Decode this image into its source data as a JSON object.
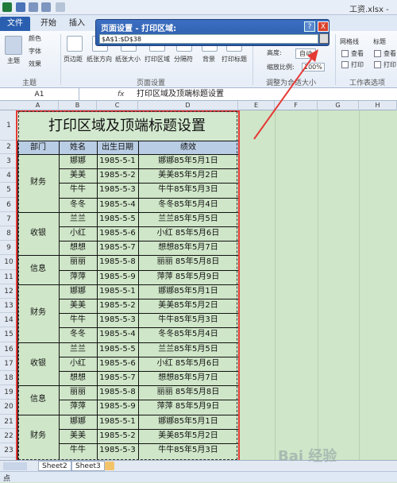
{
  "window": {
    "doc_title": "工资.xlsx - M"
  },
  "tabs": [
    {
      "label": "文件"
    },
    {
      "label": "开始"
    },
    {
      "label": "插入"
    }
  ],
  "ribbon": {
    "theme_group": {
      "theme_label": "主题",
      "colors_label": "颜色",
      "fonts_label": "字体",
      "effects_label": "效果",
      "group_label": "主题"
    },
    "page_setup": {
      "margins": "页边距",
      "orientation": "纸张方向",
      "size": "纸张大小",
      "print_area": "打印区域",
      "breaks": "分隔符",
      "background": "背景",
      "print_titles": "打印标题",
      "group_label": "页面设置"
    },
    "scale_fit": {
      "height_label": "高度:",
      "height_value": "自动",
      "scale_label": "缩放比例:",
      "scale_value": "100%",
      "group_label": "调整为合适大小"
    },
    "sheet_options": {
      "gridlines": "网格线",
      "headings": "标题",
      "view1": "查看",
      "view2": "查看",
      "print1": "打印",
      "print2": "打印",
      "group_label": "工作表选项"
    }
  },
  "dialog": {
    "title": "页面设置 - 打印区域:",
    "range": "$A$1:$D$38",
    "help": "?",
    "close": "X"
  },
  "formula_bar": {
    "name_box": "A1",
    "fx": "fx",
    "content": "打印区域及顶端标题设置"
  },
  "columns": [
    "A",
    "B",
    "C",
    "D",
    "E",
    "F",
    "G",
    "H"
  ],
  "rows": [
    "1",
    "2",
    "3",
    "4",
    "5",
    "6",
    "7",
    "8",
    "9",
    "10",
    "11",
    "12",
    "13",
    "14",
    "15",
    "16",
    "17",
    "18",
    "19",
    "20",
    "21",
    "22",
    "23"
  ],
  "sheet": {
    "title": "打印区域及顶端标题设置",
    "headers": [
      "部门",
      "姓名",
      "出生日期",
      "绩效"
    ],
    "departments": [
      {
        "label": "财务"
      },
      {
        "label": "收银"
      },
      {
        "label": "信息"
      },
      {
        "label": "财务"
      },
      {
        "label": "收银"
      },
      {
        "label": "信息"
      },
      {
        "label": "财务"
      }
    ],
    "data_rows": [
      {
        "name": "娜娜",
        "date": "1985-5-1",
        "perf": "娜娜85年5月1日"
      },
      {
        "name": "美美",
        "date": "1985-5-2",
        "perf": "美美85年5月2日"
      },
      {
        "name": "牛牛",
        "date": "1985-5-3",
        "perf": "牛牛85年5月3日"
      },
      {
        "name": "冬冬",
        "date": "1985-5-4",
        "perf": "冬冬85年5月4日"
      },
      {
        "name": "兰兰",
        "date": "1985-5-5",
        "perf": "兰兰85年5月5日"
      },
      {
        "name": "小红",
        "date": "1985-5-6",
        "perf": "小红 85年5月6日"
      },
      {
        "name": "想想",
        "date": "1985-5-7",
        "perf": "想想85年5月7日"
      },
      {
        "name": "丽丽",
        "date": "1985-5-8",
        "perf": "丽丽 85年5月8日"
      },
      {
        "name": "萍萍",
        "date": "1985-5-9",
        "perf": "萍萍 85年5月9日"
      },
      {
        "name": "娜娜",
        "date": "1985-5-1",
        "perf": "娜娜85年5月1日"
      },
      {
        "name": "美美",
        "date": "1985-5-2",
        "perf": "美美85年5月2日"
      },
      {
        "name": "牛牛",
        "date": "1985-5-3",
        "perf": "牛牛85年5月3日"
      },
      {
        "name": "冬冬",
        "date": "1985-5-4",
        "perf": "冬冬85年5月4日"
      },
      {
        "name": "兰兰",
        "date": "1985-5-5",
        "perf": "兰兰85年5月5日"
      },
      {
        "name": "小红",
        "date": "1985-5-6",
        "perf": "小红 85年5月6日"
      },
      {
        "name": "想想",
        "date": "1985-5-7",
        "perf": "想想85年5月7日"
      },
      {
        "name": "丽丽",
        "date": "1985-5-8",
        "perf": "丽丽 85年5月8日"
      },
      {
        "name": "萍萍",
        "date": "1985-5-9",
        "perf": "萍萍 85年5月9日"
      },
      {
        "name": "娜娜",
        "date": "1985-5-1",
        "perf": "娜娜85年5月1日"
      },
      {
        "name": "美美",
        "date": "1985-5-2",
        "perf": "美美85年5月2日"
      },
      {
        "name": "牛牛",
        "date": "1985-5-3",
        "perf": "牛牛85年5月3日"
      }
    ]
  },
  "sheet_tabs": [
    {
      "label": "Sheet2"
    },
    {
      "label": "Sheet3"
    }
  ],
  "status": {
    "text": "点"
  },
  "watermark": "Bai 经验",
  "colors": {
    "highlight": "#e53935",
    "accent": "#2a5fb0",
    "sheet_bg": "#cfe6c8"
  }
}
